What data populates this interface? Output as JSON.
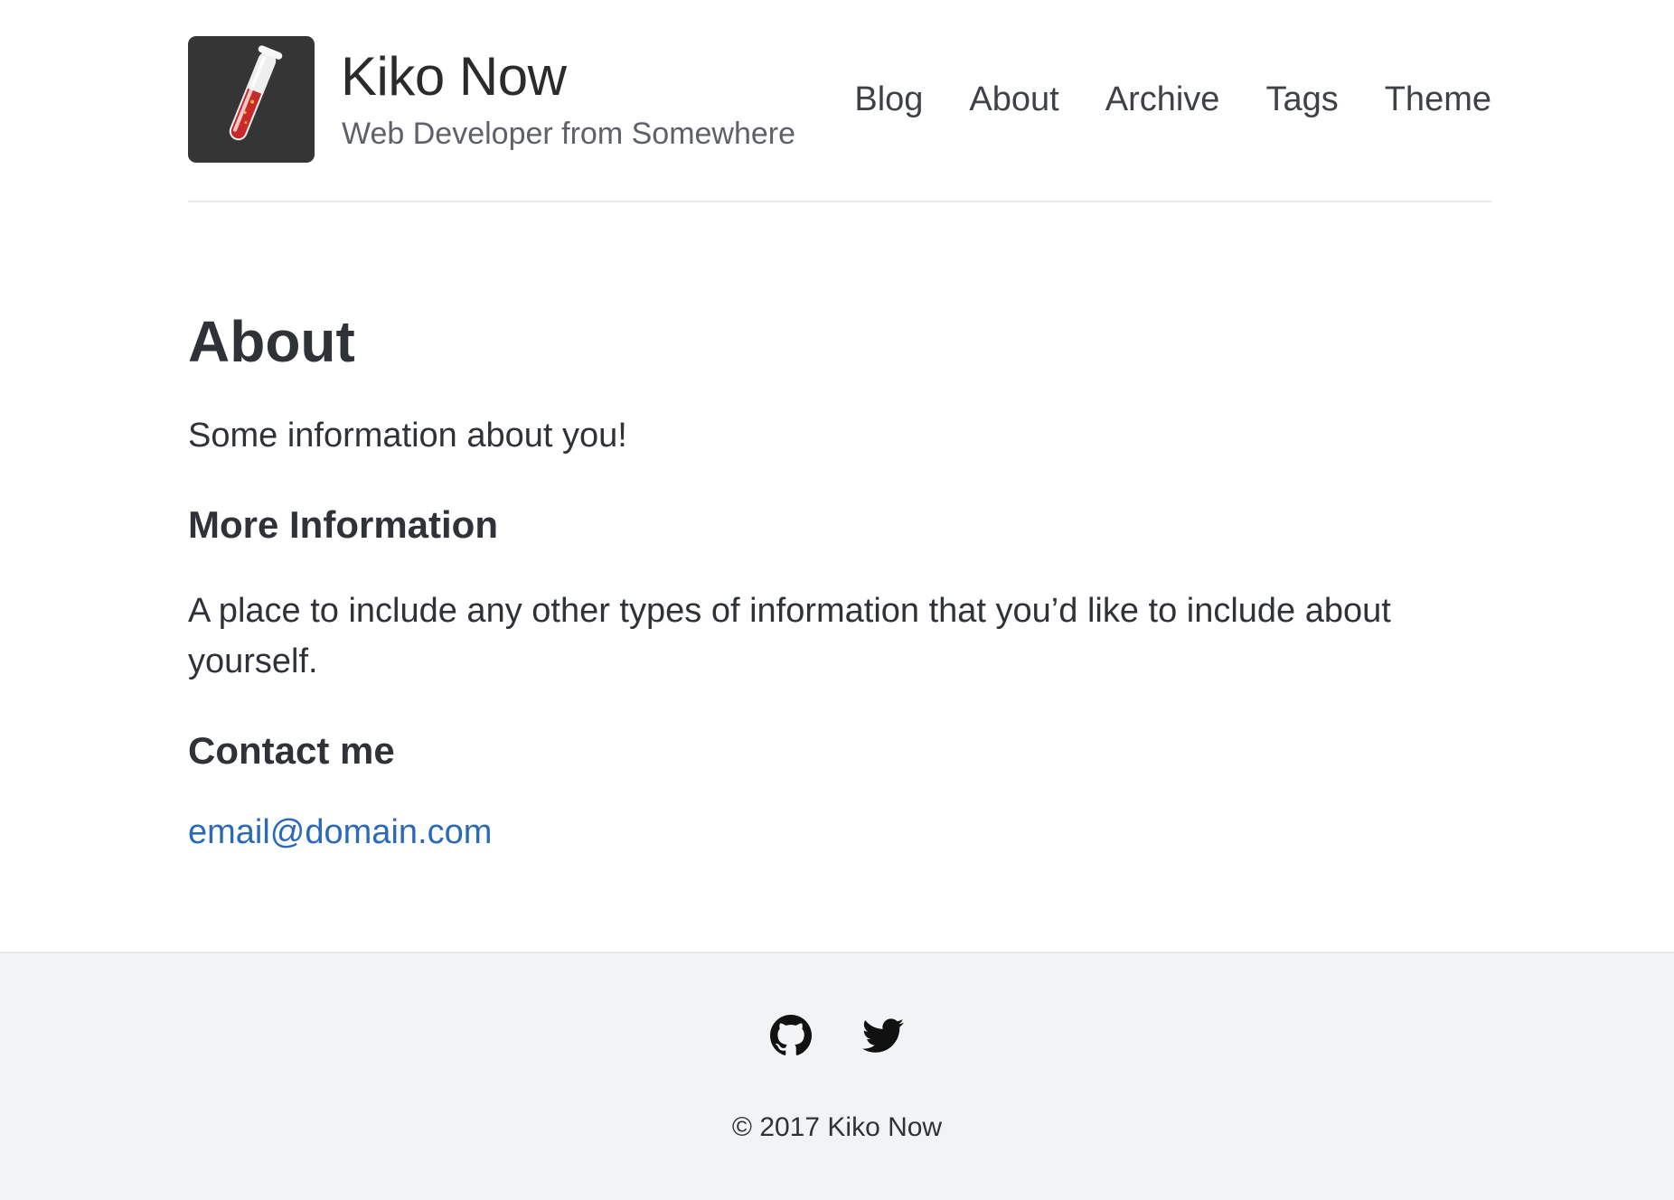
{
  "site": {
    "title": "Kiko Now",
    "tagline": "Web Developer from Somewhere",
    "logo_icon": "test-tube-icon"
  },
  "nav": {
    "items": [
      {
        "label": "Blog"
      },
      {
        "label": "About"
      },
      {
        "label": "Archive"
      },
      {
        "label": "Tags"
      },
      {
        "label": "Theme"
      }
    ]
  },
  "content": {
    "title": "About",
    "intro": "Some information about you!",
    "more_heading": "More Information",
    "more_text": "A place to include any other types of information that you’d like to include about yourself.",
    "contact_heading": "Contact me",
    "email": "email@domain.com"
  },
  "footer": {
    "social_icons": [
      "github-icon",
      "twitter-icon"
    ],
    "copyright": "© 2017 Kiko Now"
  },
  "colors": {
    "link": "#2a6ab8",
    "text": "#2f3237",
    "footer_bg": "#f2f3f5",
    "logo_bg": "#353535",
    "tube_liquid": "#c82a2a"
  }
}
